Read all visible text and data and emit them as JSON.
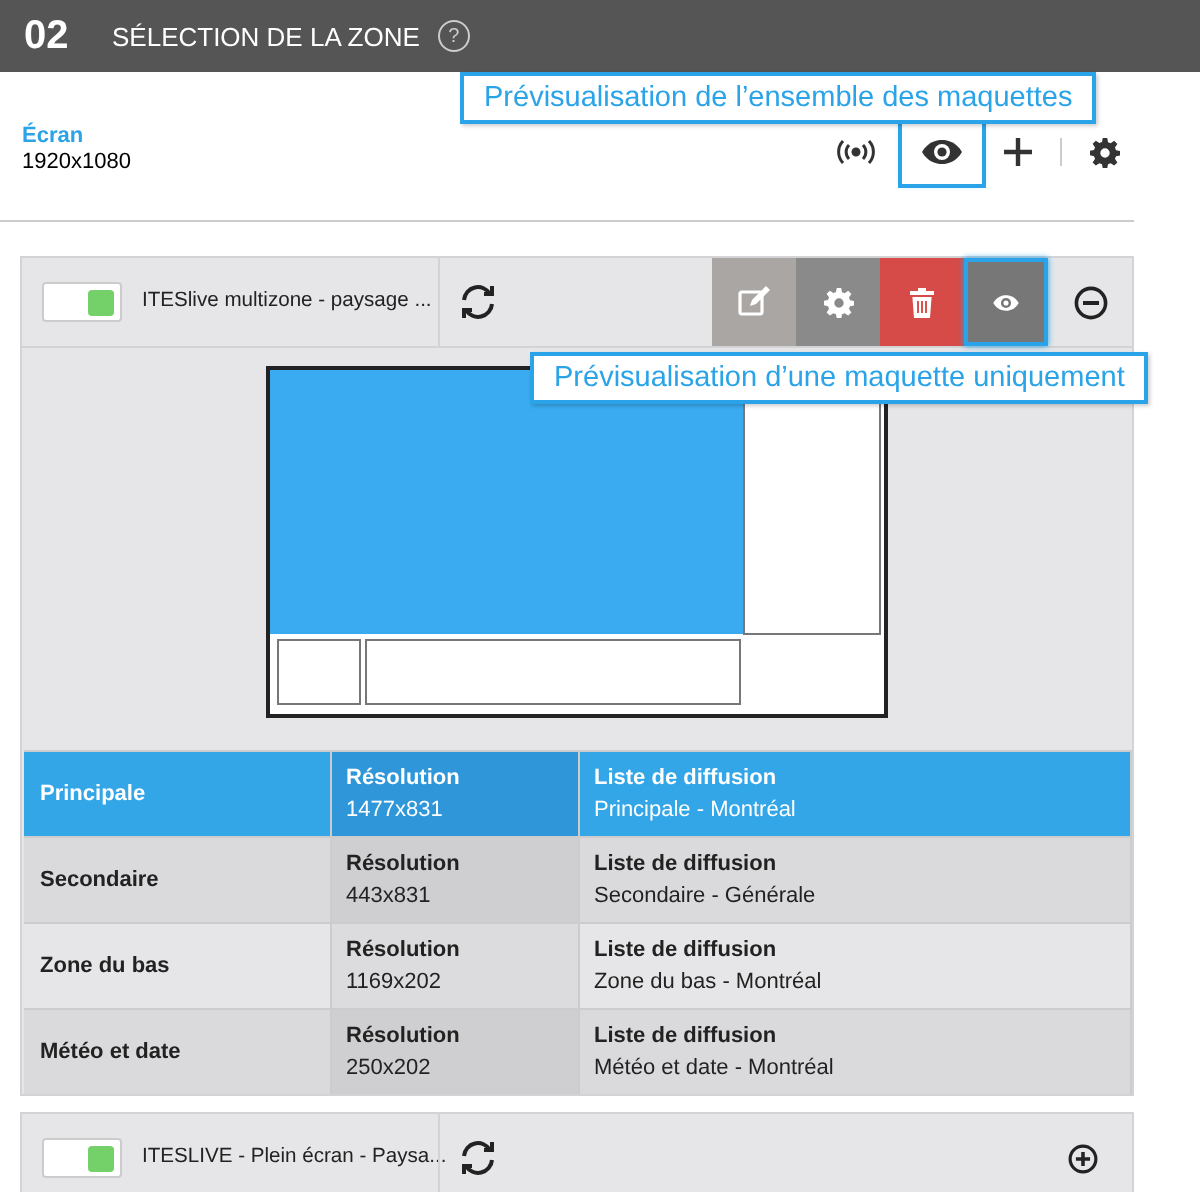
{
  "header": {
    "step": "02",
    "title": "SÉLECTION DE LA ZONE",
    "help_icon": "?"
  },
  "screen": {
    "label": "Écran",
    "resolution": "1920x1080"
  },
  "callouts": [
    "Prévisualisation de l’ensemble des maquettes",
    "Prévisualisation d’une maquette uniquement"
  ],
  "layouts": [
    {
      "title": "ITESlive multizone - paysage ...",
      "on": true,
      "expanded": true,
      "zones": [
        {
          "name": "Principale",
          "resolution_label": "Résolution",
          "resolution": "1477x831",
          "playlist_label": "Liste de diffusion",
          "playlist": "Principale - Montréal",
          "selected": true
        },
        {
          "name": "Secondaire",
          "resolution_label": "Résolution",
          "resolution": "443x831",
          "playlist_label": "Liste de diffusion",
          "playlist": "Secondaire - Générale",
          "selected": false
        },
        {
          "name": "Zone du bas",
          "resolution_label": "Résolution",
          "resolution": "1169x202",
          "playlist_label": "Liste de diffusion",
          "playlist": "Zone du bas - Montréal",
          "selected": false
        },
        {
          "name": "Météo et date",
          "resolution_label": "Résolution",
          "resolution": "250x202",
          "playlist_label": "Liste de diffusion",
          "playlist": "Météo et date - Montréal",
          "selected": false
        }
      ]
    },
    {
      "title": "ITESLIVE - Plein écran - Paysa...",
      "on": true,
      "expanded": false
    }
  ]
}
